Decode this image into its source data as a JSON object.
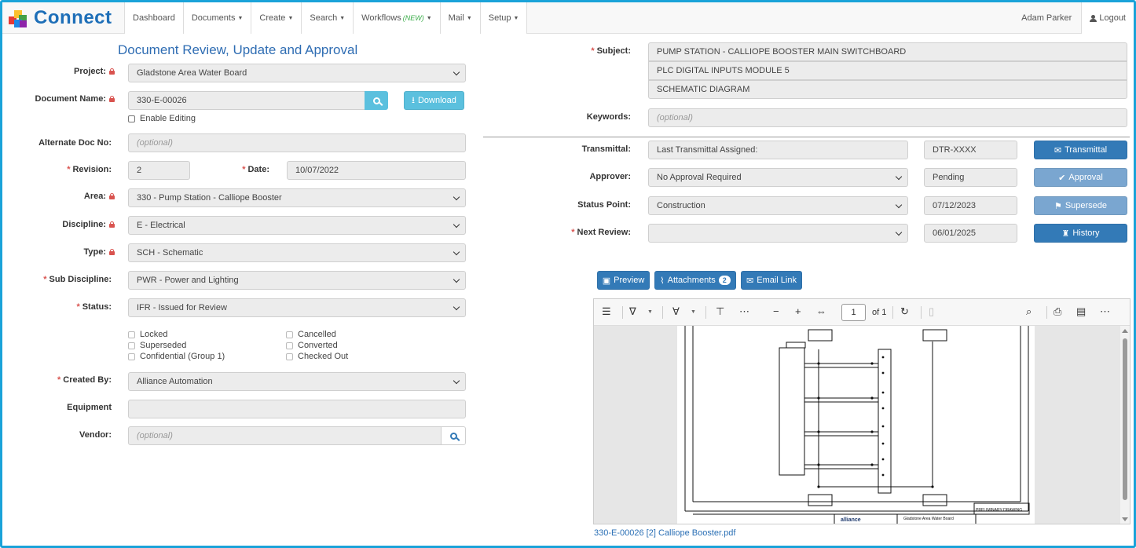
{
  "brand": {
    "name": "Connect"
  },
  "nav": {
    "dashboard": "Dashboard",
    "documents": "Documents",
    "create": "Create",
    "search": "Search",
    "workflows": "Workflows",
    "workflows_new": "(NEW)",
    "mail": "Mail",
    "setup": "Setup",
    "user": "Adam Parker",
    "logout": "Logout"
  },
  "form": {
    "title": "Document Review, Update and Approval",
    "project": {
      "label": "Project:",
      "value": "Gladstone Area Water Board"
    },
    "document_name": {
      "label": "Document Name:",
      "value": "330-E-00026",
      "download": "Download"
    },
    "enable_editing": "Enable Editing",
    "alternate_doc": {
      "label": "Alternate Doc No:",
      "placeholder": "(optional)"
    },
    "revision": {
      "label": "Revision:",
      "value": "2"
    },
    "date": {
      "label": "Date:",
      "value": "10/07/2022"
    },
    "area": {
      "label": "Area:",
      "value": "330 - Pump Station - Calliope Booster"
    },
    "discipline": {
      "label": "Discipline:",
      "value": "E - Electrical"
    },
    "type": {
      "label": "Type:",
      "value": "SCH - Schematic"
    },
    "sub_discipline": {
      "label": "Sub Discipline:",
      "value": "PWR - Power and Lighting"
    },
    "status": {
      "label": "Status:",
      "value": "IFR - Issued for Review"
    },
    "flags": {
      "locked": "Locked",
      "superseded": "Superseded",
      "confidential": "Confidential (Group 1)",
      "cancelled": "Cancelled",
      "converted": "Converted",
      "checked_out": "Checked Out"
    },
    "created_by": {
      "label": "Created By:",
      "value": "Alliance Automation"
    },
    "equipment": {
      "label": "Equipment",
      "value": ""
    },
    "vendor": {
      "label": "Vendor:",
      "placeholder": "(optional)"
    }
  },
  "right": {
    "subject": {
      "label": "Subject:",
      "line1": "PUMP STATION - CALLIOPE BOOSTER MAIN SWITCHBOARD",
      "line2": "PLC DIGITAL INPUTS MODULE 5",
      "line3": "SCHEMATIC DIAGRAM"
    },
    "keywords": {
      "label": "Keywords:",
      "placeholder": "(optional)"
    },
    "transmittal": {
      "label": "Transmittal:",
      "value": "Last Transmittal Assigned:",
      "code": "DTR-XXXX",
      "button": "Transmittal"
    },
    "approver": {
      "label": "Approver:",
      "value": "No Approval Required",
      "state": "Pending",
      "button": "Approval"
    },
    "status_point": {
      "label": "Status Point:",
      "value": "Construction",
      "date": "07/12/2023",
      "button": "Supersede"
    },
    "next_review": {
      "label": "Next Review:",
      "value": "",
      "date": "06/01/2025",
      "button": "History"
    }
  },
  "viewer": {
    "preview": "Preview",
    "attachments": "Attachments",
    "attachments_count": "2",
    "email_link": "Email Link",
    "page": "1",
    "of": "of 1",
    "filename": "330-E-00026 [2] Calliope Booster.pdf"
  },
  "drawing": {
    "stamp": "PRELIMINARY DRAWING",
    "client": "Gladstone Area Water Board",
    "logo": "alliance"
  }
}
